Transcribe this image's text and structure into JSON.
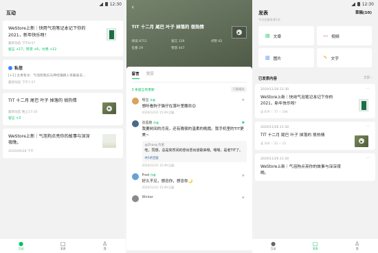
{
  "status_time": "12:30",
  "screen1": {
    "title": "互动",
    "cards": [
      {
        "text": "WeStore上新｜快用气泡笔记本记下你的2021，新年快乐呀！",
        "meta": "最新动态 下午8:07",
        "stats": "留言 +17，赞赏 +6，付费 +12"
      },
      {
        "text": "TIT 十二月 尾巴 叶子 掉落的 很热情",
        "meta": "最新动态 晚上17:16",
        "stats": "留言 +3"
      },
      {
        "text": "WeStore上新｜气泡狗点亮你的故事与深深夜晚。",
        "meta": "2020/09/28 下午"
      }
    ],
    "message": {
      "title": "私信",
      "body": "[+1] 主青有水：气泡狗我乐马神经镇颖人早最爱去…",
      "meta": "最新动态 下午7:27"
    },
    "tabs": [
      "互动",
      "发表",
      "我"
    ]
  },
  "screen2": {
    "back": "‹",
    "title": "TIT 十二月 尾巴 叶子 掉落的 很热情",
    "stats": [
      "阅读 8711",
      "留言 126",
      "点赞 62",
      "在看 29",
      "赞赏 447"
    ],
    "tabs": [
      "留言",
      "赞赏"
    ],
    "updates": "3 条留言有更新",
    "sort": "只看精选",
    "comments": [
      {
        "name": "嘤宝",
        "tag": "作者",
        "text": "想听看狗子猫仔在落叶里撒欢😊",
        "foot": "2020/12/31 15:49 回复"
      },
      {
        "name": "张嘉鹏",
        "tag": "作者",
        "text": "我要树间的月亮，还有晚宿的温柔的晚霞。我手机里的TIT更美~",
        "foot": "2020/12/31 15:49 回复",
        "reply": {
          "name": "@Zhang 作者",
          "text": "哇，同感，总是突然间的想出冒出谱歌来哦，嗯嗯，是老TIT了。"
        },
        "reply_count": "共5条回复"
      },
      {
        "name": "Fred",
        "tag": "作者",
        "text": "好久不见，想念你，想念你🌙",
        "foot": "2020/12/31 15:49 回复"
      },
      {
        "name": "Winter",
        "tag": "",
        "text": "",
        "foot": ""
      }
    ]
  },
  "screen3": {
    "title": "发表",
    "subtitle": "今天还能发表1次",
    "draft": "草稿(10)",
    "actions": [
      "文章",
      "视频",
      "图片",
      "文字"
    ],
    "section": "已发表内容",
    "section_more": "全部 ›",
    "posts": [
      {
        "date": "2020/11/26 21:30",
        "text": "WeStore上新｜快用气泡笔记本记下你的2021，新年快乐呀！",
        "meta": "读 679   ♡ 77   ☆ 104"
      },
      {
        "date": "2020/11/26 21:30",
        "text": "TIT 十二月 尾巴 叶子 掉落的 很热情",
        "meta": "读 164   ♡ 22   ☆ 15"
      },
      {
        "date": "2020/11/26 21:30",
        "text": "WeStore上新｜气泡狗点亮你的故事与深深夜晚。",
        "meta": ""
      }
    ],
    "tabs": [
      "互动",
      "发表",
      "我"
    ]
  },
  "colors": {
    "accent": "#07c160"
  }
}
